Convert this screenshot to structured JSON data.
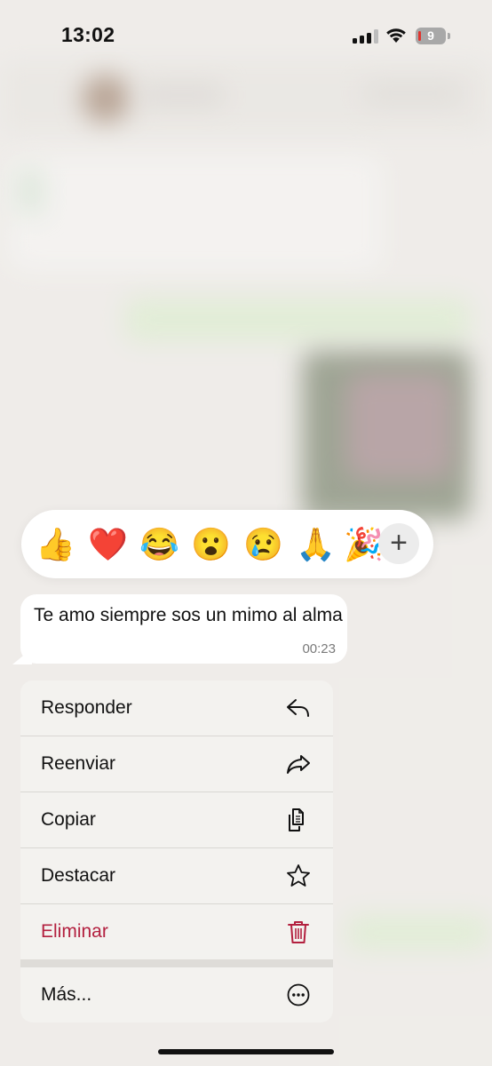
{
  "status_bar": {
    "time": "13:02",
    "battery_level": "9",
    "signal_bars": 3,
    "wifi": true
  },
  "reactions": {
    "emojis": [
      "👍",
      "❤️",
      "😂",
      "😮",
      "😢",
      "🙏",
      "🎉"
    ],
    "more_label": "+"
  },
  "message": {
    "text": "Te amo siempre sos un mimo al alma",
    "time": "00:23"
  },
  "menu": {
    "reply": "Responder",
    "forward": "Reenviar",
    "copy": "Copiar",
    "star": "Destacar",
    "delete": "Eliminar",
    "more": "Más..."
  },
  "colors": {
    "danger": "#b3203f",
    "battery_low": "#e0352f"
  }
}
